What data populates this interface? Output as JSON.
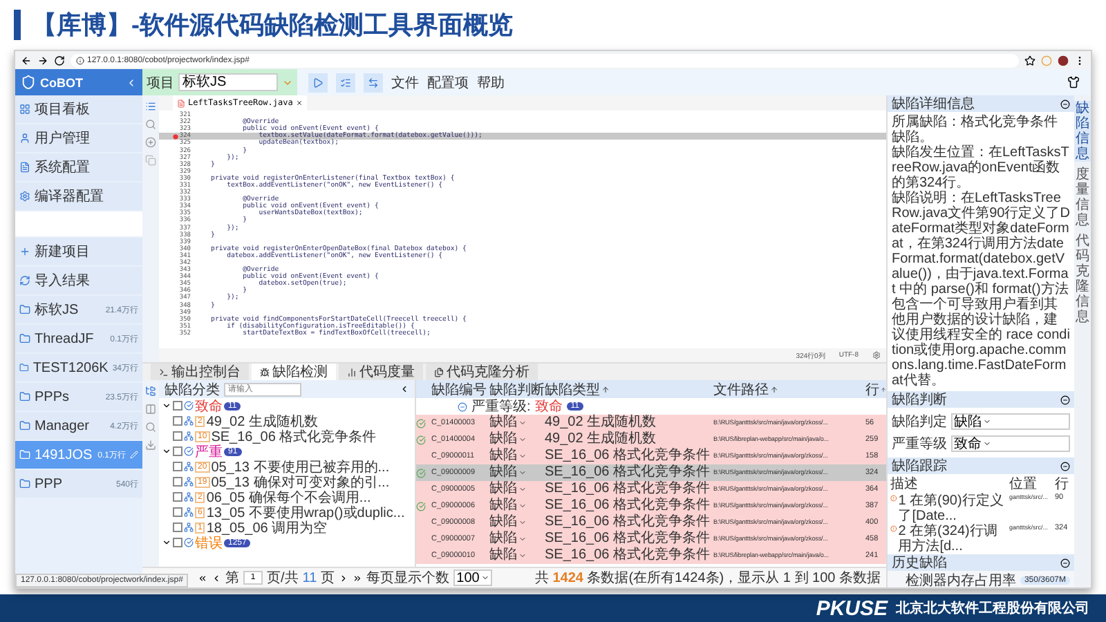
{
  "slide": {
    "title": "【库博】-软件源代码缺陷检测工具界面概览",
    "logo": "PKUSE",
    "company": "北京北大软件工程股份有限公司"
  },
  "browser": {
    "url": "127.0.0.1:8080/cobot/projectwork/index.jsp#",
    "status_url": "127.0.0.1:8080/cobot/projectwork/index.jsp#"
  },
  "app_header": {
    "logo": "CoBOT",
    "project_label": "项目",
    "project_value": "标软JS",
    "menus": [
      "文件",
      "配置项",
      "帮助"
    ]
  },
  "sidebar": {
    "nav": [
      {
        "label": "项目看板",
        "kind": "board"
      },
      {
        "label": "用户管理",
        "kind": "user"
      },
      {
        "label": "系统配置",
        "kind": "config"
      },
      {
        "label": "编译器配置",
        "kind": "compiler"
      }
    ],
    "actions": [
      {
        "label": "新建项目",
        "kind": "new"
      },
      {
        "label": "导入结果",
        "kind": "import"
      }
    ],
    "projects": [
      {
        "name": "标软JS",
        "size": "21.4万行",
        "selected": false
      },
      {
        "name": "ThreadJF",
        "size": "0.1万行",
        "selected": false
      },
      {
        "name": "TEST1206K",
        "size": "34万行",
        "selected": false
      },
      {
        "name": "PPPs",
        "size": "23.5万行",
        "selected": false
      },
      {
        "name": "Manager",
        "size": "4.2万行",
        "selected": false
      },
      {
        "name": "1491JOS",
        "size": "0.1万行",
        "selected": true
      },
      {
        "name": "PPP",
        "size": "540行",
        "selected": false
      }
    ]
  },
  "editor": {
    "tab": "LeftTasksTreeRow.java",
    "status_position": "324行0列",
    "status_encoding": "UTF-8",
    "lines": [
      {
        "number": "321",
        "highlighted": false,
        "breakpoint": false
      },
      {
        "number": "322",
        "text": "            @Override",
        "highlighted": false,
        "breakpoint": false
      },
      {
        "number": "323",
        "text": "            public void onEvent(Event event) {",
        "highlighted": false,
        "breakpoint": false
      },
      {
        "number": "324",
        "text": "                textbox.setValue(dateFormat.format(datebox.getValue()));",
        "highlighted": true,
        "breakpoint": true
      },
      {
        "number": "325",
        "text": "                updateBean(textbox);",
        "highlighted": false,
        "breakpoint": false
      },
      {
        "number": "326",
        "text": "            }",
        "highlighted": false,
        "breakpoint": false
      },
      {
        "number": "327",
        "text": "        });",
        "highlighted": false,
        "breakpoint": false
      },
      {
        "number": "328",
        "text": "    }",
        "highlighted": false,
        "breakpoint": false
      },
      {
        "number": "329",
        "highlighted": false,
        "breakpoint": false
      },
      {
        "number": "330",
        "text": "    private void registerOnEnterListener(final Textbox textBox) {",
        "highlighted": false,
        "breakpoint": false
      },
      {
        "number": "331",
        "text": "        textBox.addEventListener(\"onOK\", new EventListener() {",
        "highlighted": false,
        "breakpoint": false
      },
      {
        "number": "332",
        "highlighted": false,
        "breakpoint": false
      },
      {
        "number": "333",
        "text": "            @Override",
        "highlighted": false,
        "breakpoint": false
      },
      {
        "number": "334",
        "text": "            public void onEvent(Event event) {",
        "highlighted": false,
        "breakpoint": false
      },
      {
        "number": "335",
        "text": "                userWantsDateBox(textBox);",
        "highlighted": false,
        "breakpoint": false
      },
      {
        "number": "336",
        "text": "            }",
        "highlighted": false,
        "breakpoint": false
      },
      {
        "number": "337",
        "text": "        });",
        "highlighted": false,
        "breakpoint": false
      },
      {
        "number": "338",
        "text": "    }",
        "highlighted": false,
        "breakpoint": false
      },
      {
        "number": "339",
        "highlighted": false,
        "breakpoint": false
      },
      {
        "number": "340",
        "text": "    private void registerOnEnterOpenDateBox(final Datebox datebox) {",
        "highlighted": false,
        "breakpoint": false
      },
      {
        "number": "341",
        "text": "        datebox.addEventListener(\"onOK\", new EventListener() {",
        "highlighted": false,
        "breakpoint": false
      },
      {
        "number": "342",
        "highlighted": false,
        "breakpoint": false
      },
      {
        "number": "343",
        "text": "            @Override",
        "highlighted": false,
        "breakpoint": false
      },
      {
        "number": "344",
        "text": "            public void onEvent(Event event) {",
        "highlighted": false,
        "breakpoint": false
      },
      {
        "number": "345",
        "text": "                datebox.setOpen(true);",
        "highlighted": false,
        "breakpoint": false
      },
      {
        "number": "346",
        "text": "            }",
        "highlighted": false,
        "breakpoint": false
      },
      {
        "number": "347",
        "text": "        });",
        "highlighted": false,
        "breakpoint": false
      },
      {
        "number": "348",
        "text": "    }",
        "highlighted": false,
        "breakpoint": false
      },
      {
        "number": "349",
        "highlighted": false,
        "breakpoint": false
      },
      {
        "number": "350",
        "text": "    private void findComponentsForStartDateCell(Treecell treecell) {",
        "highlighted": false,
        "breakpoint": false
      },
      {
        "number": "351",
        "text": "        if (disabilityConfiguration.isTreeEditable()) {",
        "highlighted": false,
        "breakpoint": false
      },
      {
        "number": "352",
        "text": "            startDateTextBox = findTextBoxOfCell(treecell);",
        "highlighted": false,
        "breakpoint": false
      }
    ]
  },
  "bottom_tabs": [
    {
      "label": "输出控制台",
      "selected": false
    },
    {
      "label": "缺陷检测",
      "selected": true
    },
    {
      "label": "代码度量",
      "selected": false
    },
    {
      "label": "代码克隆分析",
      "selected": false
    }
  ],
  "defect_tree": {
    "title": "缺陷分类",
    "search_placeholder": "请输入",
    "groups": [
      {
        "label": "致命",
        "count": "11",
        "color": "#e53935",
        "expanded": true,
        "checked": false,
        "children": [
          {
            "count": "2",
            "label": "49_02 生成随机数",
            "checked": false
          },
          {
            "count": "10",
            "label": "SE_16_06 格式化竞争条件",
            "checked": false
          }
        ]
      },
      {
        "label": "严重",
        "count": "91",
        "color": "#d81b9a",
        "expanded": true,
        "checked": false,
        "children": [
          {
            "count": "20",
            "label": "05_13 不要使用已被弃用的...",
            "checked": false
          },
          {
            "count": "19",
            "label": "05_13 确保对可变对象的引...",
            "checked": false
          },
          {
            "count": "2",
            "label": "06_05 确保每个不会调用...",
            "checked": false
          },
          {
            "count": "6",
            "label": "13_05 不要使用wrap()或duplic...",
            "checked": false
          },
          {
            "count": "1",
            "label": "18_05_06 调用为空",
            "checked": false
          }
        ]
      },
      {
        "label": "错误",
        "count": "1257",
        "color": "#f57c00",
        "expanded": true,
        "checked": false
      }
    ]
  },
  "defect_table": {
    "columns": [
      {
        "label": "缺陷编号",
        "sortable": false
      },
      {
        "label": "缺陷判断",
        "sortable": false
      },
      {
        "label": "缺陷类型",
        "sortable": true
      },
      {
        "label": "文件路径",
        "sortable": true
      },
      {
        "label": "行",
        "sortable": true
      }
    ],
    "group_row": {
      "label": "严重等级:",
      "value": "致命",
      "count": "11"
    },
    "rows": [
      {
        "marked": true,
        "id": "C_01400003",
        "judgement": "缺陷",
        "type": "49_02 生成随机数",
        "path": "B:\\RUS/gantttsk/src/main/java/org/zkoss/...",
        "line": "56",
        "selected": false
      },
      {
        "marked": true,
        "id": "C_01400004",
        "judgement": "缺陷",
        "type": "49_02 生成随机数",
        "path": "B:\\RUS/libreplan-webapp/src/main/java/o...",
        "line": "259",
        "selected": false
      },
      {
        "marked": false,
        "id": "C_09000011",
        "judgement": "缺陷",
        "type": "SE_16_06 格式化竞争条件",
        "path": "B:\\RUS/gantttsk/src/main/java/org/zkoss/...",
        "line": "158",
        "selected": false
      },
      {
        "marked": true,
        "id": "C_09000009",
        "judgement": "缺陷",
        "type": "SE_16_06 格式化竞争条件",
        "path": "B:\\RUS/gantttsk/src/main/java/org/zkoss/...",
        "line": "324",
        "selected": true
      },
      {
        "marked": false,
        "id": "C_09000005",
        "judgement": "缺陷",
        "type": "SE_16_06 格式化竞争条件",
        "path": "B:\\RUS/gantttsk/src/main/java/org/zkoss/...",
        "line": "364",
        "selected": false
      },
      {
        "marked": true,
        "id": "C_09000006",
        "judgement": "缺陷",
        "type": "SE_16_06 格式化竞争条件",
        "path": "B:\\RUS/gantttsk/src/main/java/org/zkoss/...",
        "line": "387",
        "selected": false
      },
      {
        "marked": false,
        "id": "C_09000008",
        "judgement": "缺陷",
        "type": "SE_16_06 格式化竞争条件",
        "path": "B:\\RUS/gantttsk/src/main/java/org/zkoss/...",
        "line": "400",
        "selected": false
      },
      {
        "marked": false,
        "id": "C_09000007",
        "judgement": "缺陷",
        "type": "SE_16_06 格式化竞争条件",
        "path": "B:\\RUS/gantttsk/src/main/java/org/zkoss/...",
        "line": "458",
        "selected": false
      },
      {
        "marked": false,
        "id": "C_09000010",
        "judgement": "缺陷",
        "type": "SE_16_06 格式化竞争条件",
        "path": "B:\\RUS/libreplan-webapp/src/main/java/o...",
        "line": "241",
        "selected": false
      }
    ]
  },
  "pagination": {
    "page_prefix": "第",
    "page": "1",
    "page_middle": "页/共",
    "pages": "11",
    "page_suffix": "页",
    "per_page_label": "每页显示个数",
    "per_page": "100",
    "summary": "共 **1424** 条数据(在所有1424条)，显示从 1 到 100 条数据"
  },
  "detail_panel": {
    "title": "缺陷详细信息",
    "paragraphs": [
      "所属缺陷：格式化竞争条件缺陷。",
      "缺陷发生位置：在LeftTasksTreeRow.java的onEvent函数的第324行。",
      "缺陷说明：在LeftTasksTreeRow.java文件第90行定义了DateFormat类型对象dateFormat，在第324行调用方法dateFormat.format(datebox.getValue())，由于java.text.Format 中的 parse()和 format()方法包含一个可导致用户看到其他用户数据的设计缺陷，建议使用线程安全的 race condition或使用org.apache.commons.lang.time.FastDateFormat代替。"
    ]
  },
  "judgement_panel": {
    "title": "缺陷判断",
    "fields": [
      {
        "label": "缺陷判定",
        "value": "缺陷"
      },
      {
        "label": "严重等级",
        "value": "致命"
      }
    ]
  },
  "tracking_panel": {
    "title": "缺陷跟踪",
    "columns": [
      "描述",
      "位置",
      "行"
    ],
    "rows": [
      {
        "description": "1 在第(90)行定义了[Date...",
        "location": "gantttsk/src/...",
        "line": "90"
      },
      {
        "description": "2 在第(324)行调用方法[d...",
        "location": "gantttsk/src/...",
        "line": "324"
      }
    ]
  },
  "history_panel": {
    "title": "历史缺陷"
  },
  "memory": {
    "label": "检测器内存占用率",
    "value": "350/3607M"
  },
  "side_tabs": [
    {
      "label": "缺陷信息",
      "selected": true
    },
    {
      "label": "度量信息",
      "selected": false
    },
    {
      "label": "代码克隆信息",
      "selected": false
    }
  ]
}
